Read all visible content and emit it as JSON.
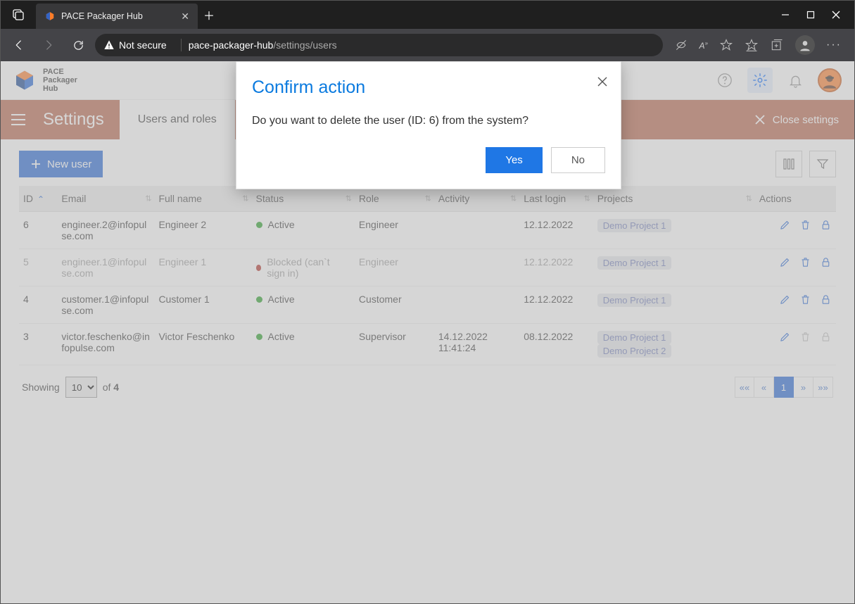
{
  "browser": {
    "tab_title": "PACE Packager Hub",
    "security_label": "Not secure",
    "url_host": "pace-packager-hub",
    "url_path": "/settings/users"
  },
  "app": {
    "brand_line1": "PACE",
    "brand_line2": "Packager",
    "brand_line3": "Hub"
  },
  "subheader": {
    "title": "Settings",
    "tab": "Users and roles",
    "close": "Close settings"
  },
  "toolbar": {
    "new_user": "New user"
  },
  "table": {
    "headers": {
      "id": "ID",
      "email": "Email",
      "full_name": "Full name",
      "status": "Status",
      "role": "Role",
      "activity": "Activity",
      "last_login": "Last login",
      "projects": "Projects",
      "actions": "Actions"
    },
    "rows": [
      {
        "id": "6",
        "email": "engineer.2@infopulse.com",
        "full_name": "Engineer 2",
        "status_color": "green",
        "status_text": "Active",
        "role": "Engineer",
        "activity": "",
        "last_login": "12.12.2022",
        "projects": [
          "Demo Project 1"
        ],
        "dim": false,
        "actions_disabled": false
      },
      {
        "id": "5",
        "email": "engineer.1@infopulse.com",
        "full_name": "Engineer 1",
        "status_color": "red",
        "status_text": "Blocked (can`t sign in)",
        "role": "Engineer",
        "activity": "",
        "last_login": "12.12.2022",
        "projects": [
          "Demo Project 1"
        ],
        "dim": true,
        "actions_disabled": false
      },
      {
        "id": "4",
        "email": "customer.1@infopulse.com",
        "full_name": "Customer 1",
        "status_color": "green",
        "status_text": "Active",
        "role": "Customer",
        "activity": "",
        "last_login": "12.12.2022",
        "projects": [
          "Demo Project 1"
        ],
        "dim": false,
        "actions_disabled": false
      },
      {
        "id": "3",
        "email": "victor.feschenko@infopulse.com",
        "full_name": "Victor Feschenko",
        "status_color": "green",
        "status_text": "Active",
        "role": "Supervisor",
        "activity": "14.12.2022 11:41:24",
        "last_login": "08.12.2022",
        "projects": [
          "Demo Project 1",
          "Demo Project 2"
        ],
        "dim": false,
        "actions_disabled": true
      }
    ]
  },
  "footer": {
    "showing": "Showing",
    "page_size": "10",
    "of": "of",
    "total": "4",
    "pages": {
      "first": "««",
      "prev": "«",
      "current": "1",
      "next": "»",
      "last": "»»"
    }
  },
  "modal": {
    "title": "Confirm action",
    "text": "Do you want to delete the user (ID: 6) from the system?",
    "yes": "Yes",
    "no": "No"
  }
}
